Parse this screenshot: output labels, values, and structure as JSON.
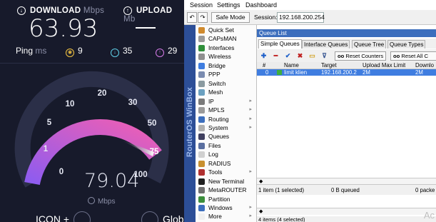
{
  "speedtest": {
    "download_label": "DOWNLOAD",
    "download_unit": "Mbps",
    "upload_label": "UPLOAD",
    "upload_unit": "Mb",
    "download_value": "63.93",
    "ping_label": "Ping",
    "ping_unit": "ms",
    "ping_value": "9",
    "down_ping": "35",
    "up_ping": "29",
    "gauge_ticks": [
      "0",
      "1",
      "5",
      "10",
      "20",
      "30",
      "50",
      "75",
      "100"
    ],
    "gauge_value": "79.04",
    "gauge_unit": "Mbps",
    "bottom_left": "ICON +",
    "bottom_right": "Global Mo",
    "needle_value": 79.04,
    "colors": {
      "bg": "#171a2b",
      "arc_start": "#9b6cf0",
      "arc_end": "#e35dc0"
    }
  },
  "winbox": {
    "menu": [
      "Session",
      "Settings",
      "Dashboard"
    ],
    "safe_mode_label": "Safe Mode",
    "session_label": "Session:",
    "session_value": "192.168.200.254",
    "brand": "RouterOS WinBox",
    "sidebar_items": [
      {
        "label": "Quick Set",
        "icon": "quickset-icon",
        "color": "#d08a2e"
      },
      {
        "label": "CAPsMAN",
        "icon": "capsman-icon",
        "color": "#9a9a9a"
      },
      {
        "label": "Interfaces",
        "icon": "interfaces-icon",
        "color": "#2f8f3a"
      },
      {
        "label": "Wireless",
        "icon": "wireless-icon",
        "color": "#8f8f8f"
      },
      {
        "label": "Bridge",
        "icon": "bridge-icon",
        "color": "#3f7de0"
      },
      {
        "label": "PPP",
        "icon": "ppp-icon",
        "color": "#7a8bb0"
      },
      {
        "label": "Switch",
        "icon": "switch-icon",
        "color": "#8a9aa0"
      },
      {
        "label": "Mesh",
        "icon": "mesh-icon",
        "color": "#6aa0c0"
      },
      {
        "label": "IP",
        "icon": "ip-icon",
        "color": "#7a7a7a",
        "arrow": true
      },
      {
        "label": "MPLS",
        "icon": "mpls-icon",
        "color": "#9a9a9a",
        "arrow": true
      },
      {
        "label": "Routing",
        "icon": "routing-icon",
        "color": "#3c6ebd",
        "arrow": true
      },
      {
        "label": "System",
        "icon": "system-icon",
        "color": "#b0b0b0",
        "arrow": true
      },
      {
        "label": "Queues",
        "icon": "queues-icon",
        "color": "#404060"
      },
      {
        "label": "Files",
        "icon": "files-icon",
        "color": "#5a6fa0"
      },
      {
        "label": "Log",
        "icon": "log-icon",
        "color": "#d0d0d0"
      },
      {
        "label": "RADIUS",
        "icon": "radius-icon",
        "color": "#c89030"
      },
      {
        "label": "Tools",
        "icon": "tools-icon",
        "color": "#b03030",
        "arrow": true
      },
      {
        "label": "New Terminal",
        "icon": "terminal-icon",
        "color": "#202020"
      },
      {
        "label": "MetaROUTER",
        "icon": "metarouter-icon",
        "color": "#707070"
      },
      {
        "label": "Partition",
        "icon": "partition-icon",
        "color": "#3c8f3c"
      },
      {
        "label": "Windows",
        "icon": "windows-icon",
        "color": "#3c6ebd",
        "arrow": true
      },
      {
        "label": "More",
        "icon": "more-icon",
        "color": "#f0f0f0",
        "arrow": true
      }
    ],
    "queue_list_title": "Queue List",
    "tabs": [
      "Simple Queues",
      "Interface Queues",
      "Queue Tree",
      "Queue Types"
    ],
    "reset_counters": "Reset Counters",
    "reset_all": "Reset All C",
    "columns": [
      "#",
      "Name",
      "Target",
      "Upload Max Limit",
      "Downlo"
    ],
    "rows": [
      {
        "num": "0",
        "name": "limit klien",
        "target": "192.168.200.2",
        "upload": "2M",
        "download": "2M"
      }
    ],
    "status_selected": "1 item (1 selected)",
    "status_queued": "0 B queued",
    "status_packets": "0 packe",
    "status_bottom": "4 items (4 selected)",
    "watermark": "Ac"
  }
}
